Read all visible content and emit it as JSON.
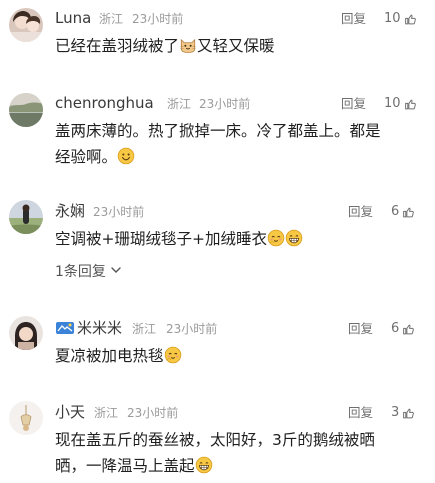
{
  "comments": [
    {
      "name": "Luna",
      "location": "浙江",
      "time": "23小时前",
      "reply_label": "回复",
      "likes": "10",
      "text_a": "已经在盖羽绒被了",
      "text_b": "又轻又保暖"
    },
    {
      "name": "chenronghua",
      "location": "浙江",
      "time": "23小时前",
      "reply_label": "回复",
      "likes": "10",
      "line1": "盖两床薄的。热了掀掉一床。冷了都盖上。都是",
      "line2": "经验啊。"
    },
    {
      "name": "永娴",
      "time": "23小时前",
      "reply_label": "回复",
      "likes": "6",
      "text": "空调被+珊瑚绒毯子+加绒睡衣",
      "more_replies": "1条回复"
    },
    {
      "name": "米米米",
      "location": "浙江",
      "time": "23小时前",
      "reply_label": "回复",
      "likes": "6",
      "text": "夏凉被加电热毯"
    },
    {
      "name": "小天",
      "location": "浙江",
      "time": "23小时前",
      "reply_label": "回复",
      "likes": "3",
      "line1": "现在盖五斤的蚕丝被，太阳好，3斤的鹅绒被晒",
      "line2": "晒，一降温马上盖起"
    }
  ],
  "colors": {
    "name": "#3a3a3a",
    "meta": "#9a9a9a",
    "text": "#1f1f1f",
    "action": "#6f6f6f"
  },
  "icons": {
    "like": "thumb-up-icon",
    "expand": "chevron-down-icon"
  }
}
